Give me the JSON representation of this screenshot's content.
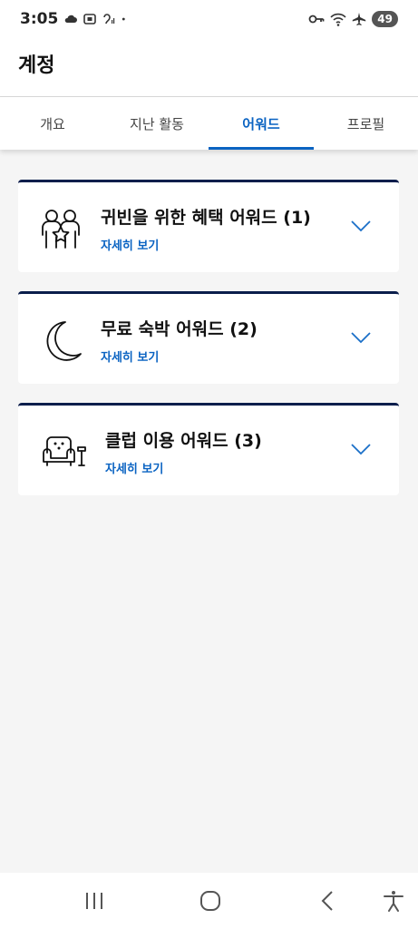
{
  "status_bar": {
    "time": "3:05",
    "battery": "49"
  },
  "header": {
    "title": "계정"
  },
  "tabs": [
    {
      "label": "개요",
      "active": false
    },
    {
      "label": "지난 활동",
      "active": false
    },
    {
      "label": "어워드",
      "active": true
    },
    {
      "label": "프로필",
      "active": false
    }
  ],
  "awards": [
    {
      "title": "귀빈을 위한 혜택 어워드 (1)",
      "link": "자세히 보기",
      "icon": "vip-guests-icon"
    },
    {
      "title": "무료 숙박 어워드 (2)",
      "link": "자세히 보기",
      "icon": "crescent-moon-icon"
    },
    {
      "title": "클럽 이용 어워드 (3)",
      "link": "자세히 보기",
      "icon": "lounge-chair-icon"
    }
  ],
  "colors": {
    "accent": "#0a63c2",
    "card_border": "#0b1e4c",
    "background": "#f5f5f5"
  }
}
